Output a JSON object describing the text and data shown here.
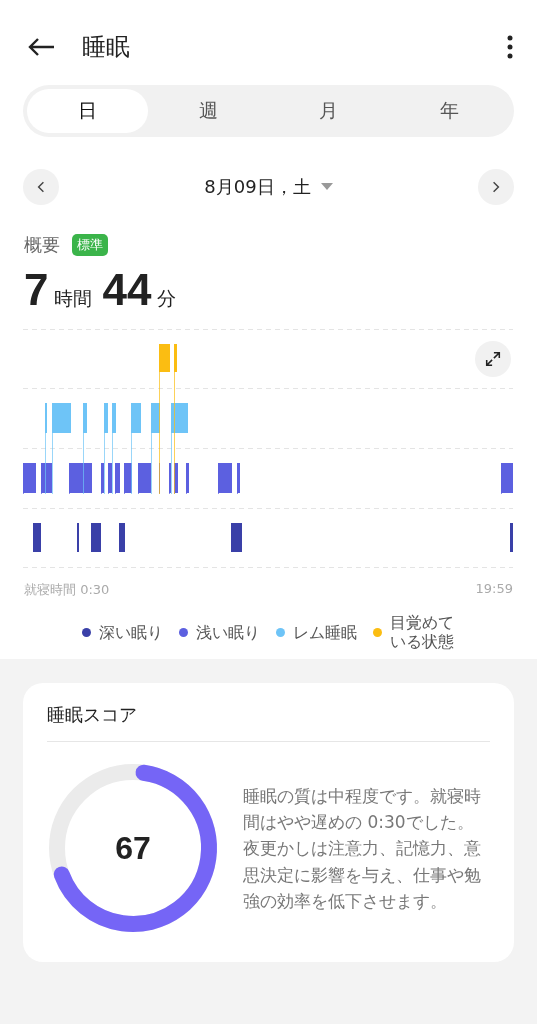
{
  "header": {
    "title": "睡眠"
  },
  "tabs": [
    {
      "label": "日",
      "selected": true
    },
    {
      "label": "週",
      "selected": false
    },
    {
      "label": "月",
      "selected": false
    },
    {
      "label": "年",
      "selected": false
    }
  ],
  "date": {
    "label": "8月09日，土"
  },
  "summary": {
    "label": "概要",
    "badge": "標準",
    "hours": "7",
    "hours_unit": "時間",
    "minutes": "44",
    "minutes_unit": "分"
  },
  "chart": {
    "start_label": "就寝時間 0:30",
    "end_label": "19:59"
  },
  "legend": [
    {
      "label": "深い眠り",
      "color": "#3a40a8"
    },
    {
      "label": "浅い眠り",
      "color": "#5c60e0"
    },
    {
      "label": "レム睡眠",
      "color": "#6ec4f7"
    },
    {
      "label": "目覚めている状態",
      "color": "#fbbd12"
    }
  ],
  "score": {
    "title": "睡眠スコア",
    "value": "67",
    "level": 0.67,
    "description": "睡眠の質は中程度です。就寝時間はやや遅めの 0:30でした。夜更かしは注意力、記憶力、意思決定に影響を与え、仕事や勉強の効率を低下させます。"
  }
}
